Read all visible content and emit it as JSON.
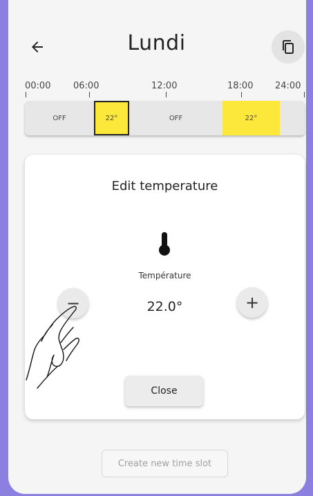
{
  "header": {
    "title": "Lundi"
  },
  "icons": {
    "back": "arrow-left",
    "copy": "copy",
    "thermometer": "thermometer",
    "hand": "touch-hand"
  },
  "timeline": {
    "labels": [
      "00:00",
      "06:00",
      "12:00",
      "18:00",
      "24:00"
    ],
    "slots": [
      {
        "label": "OFF",
        "state": "off"
      },
      {
        "label": "22°",
        "state": "on",
        "selected": true
      },
      {
        "label": "OFF",
        "state": "off"
      },
      {
        "label": "22°",
        "state": "on"
      }
    ],
    "on_color": "#fbe83a"
  },
  "editor": {
    "title": "Edit temperature",
    "temp_label": "Température",
    "temp_value": "22.0°",
    "minus_label": "−",
    "plus_label": "+",
    "close_label": "Close"
  },
  "footer": {
    "create_label": "Create new time slot"
  },
  "colors": {
    "frame": "#8b7fe0",
    "accent_yellow": "#fbe83a"
  }
}
